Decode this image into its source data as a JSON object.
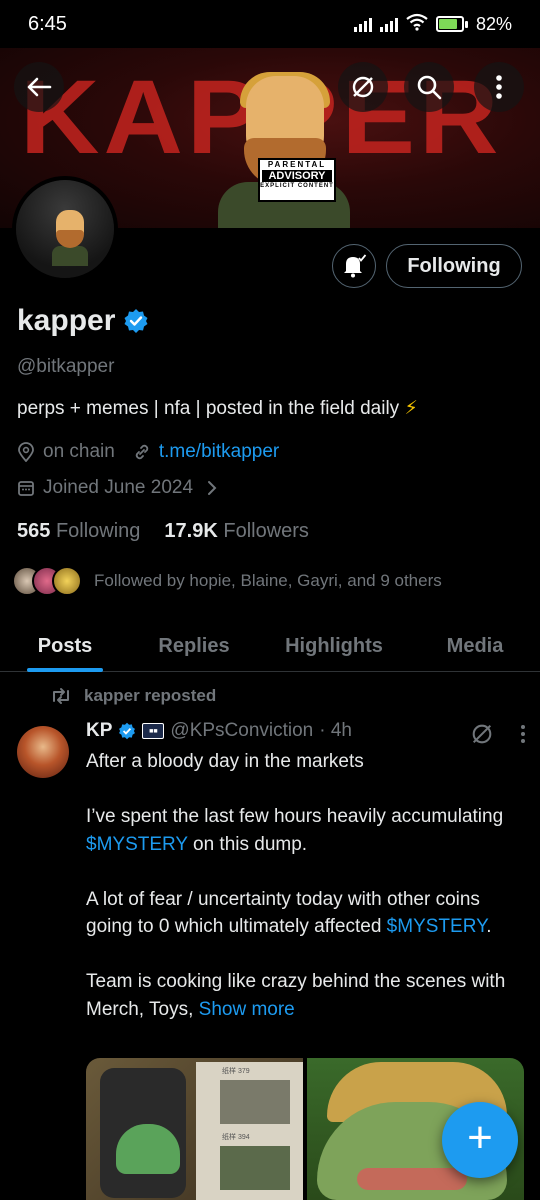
{
  "status": {
    "time": "6:45",
    "battery": "82%",
    "battery_level": 0.82
  },
  "profile": {
    "display_name": "kapper",
    "handle": "@bitkapper",
    "bio": "perps + memes | nfa | posted in the field daily",
    "bio_emoji": "⚡",
    "location": "on chain",
    "link": "t.me/bitkapper",
    "joined": "Joined June 2024",
    "following_count": "565",
    "following_label": "Following",
    "followers_count": "17.9K",
    "followers_label": "Followers",
    "followed_by": "Followed by hopie, Blaine, Gayri, and 9 others",
    "follow_button_label": "Following"
  },
  "banner": {
    "word": "KAPPER",
    "advisory_line1": "PARENTAL",
    "advisory_line2": "ADVISORY",
    "advisory_line3": "EXPLICIT CONTENT"
  },
  "tabs": [
    "Posts",
    "Replies",
    "Highlights",
    "Media"
  ],
  "active_tab": "Posts",
  "post": {
    "repost_label": "kapper reposted",
    "author_name": "KP",
    "author_handle": "@KPsConviction",
    "time": "· 4h",
    "line1": "After a bloody day in the markets",
    "p2_a": "I’ve spent the last few hours heavily accumulating ",
    "p2_cash": "$MYSTERY",
    "p2_b": " on this dump.",
    "p3_a": "A lot of fear / uncertainty today with other coins going to 0 which ultimately affected ",
    "p3_cash": "$MYSTERY",
    "p3_b": ".",
    "p4_a": "Team is cooking like crazy behind the scenes with Merch, Toys, ",
    "show_more": "Show more"
  },
  "media_labels": {
    "note1": "纸样 379",
    "note2": "纸样 394"
  },
  "colors": {
    "accent": "#1d9bf0",
    "text": "#e7e9ea",
    "muted": "#71767b"
  }
}
